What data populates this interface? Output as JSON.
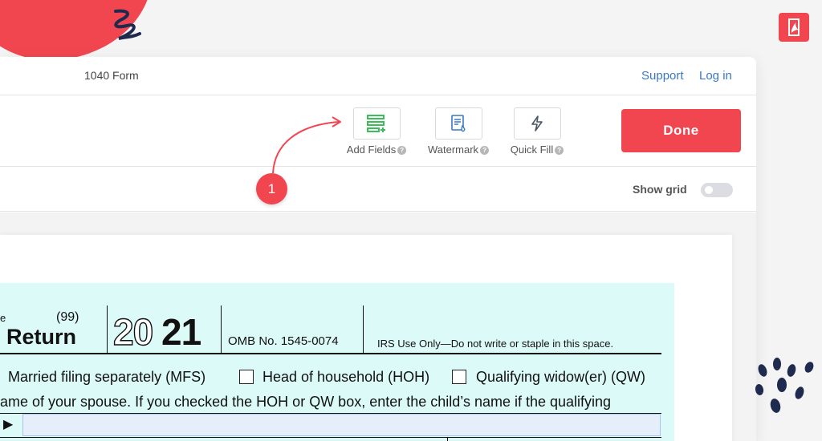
{
  "document": {
    "title": "1040 Form"
  },
  "nav": {
    "support_label": "Support",
    "login_label": "Log in"
  },
  "toolbar": {
    "tools": [
      {
        "label": "Add Fields",
        "icon": "add-fields-icon"
      },
      {
        "label": "Watermark",
        "icon": "watermark-icon"
      },
      {
        "label": "Quick Fill",
        "icon": "lightning-icon"
      }
    ],
    "help_glyph": "?",
    "done_label": "Done"
  },
  "grid": {
    "label": "Show grid",
    "enabled": false
  },
  "annotation": {
    "step_number": "1"
  },
  "form": {
    "cut_label": "e",
    "code": "(99)",
    "return_label": "Return",
    "year_outline": "20",
    "year_bold": "21",
    "omb": "OMB No. 1545-0074",
    "irs_note": "IRS Use Only—Do not write or staple in this space.",
    "filing_mfs": "Married filing separately (MFS)",
    "filing_hoh": "Head of household (HOH)",
    "filing_qw": "Qualifying widow(er) (QW)",
    "spouse_line": "ame of your spouse. If you checked the HOH or QW box, enter the child’s name if the qualifying",
    "pointer_glyph": "▶"
  },
  "colors": {
    "accent": "#f1464f",
    "link": "#3a78c4",
    "form_bg": "#dcfbf8",
    "field_bg": "#e6eefb",
    "add_fields_green": "#3bbd57"
  }
}
